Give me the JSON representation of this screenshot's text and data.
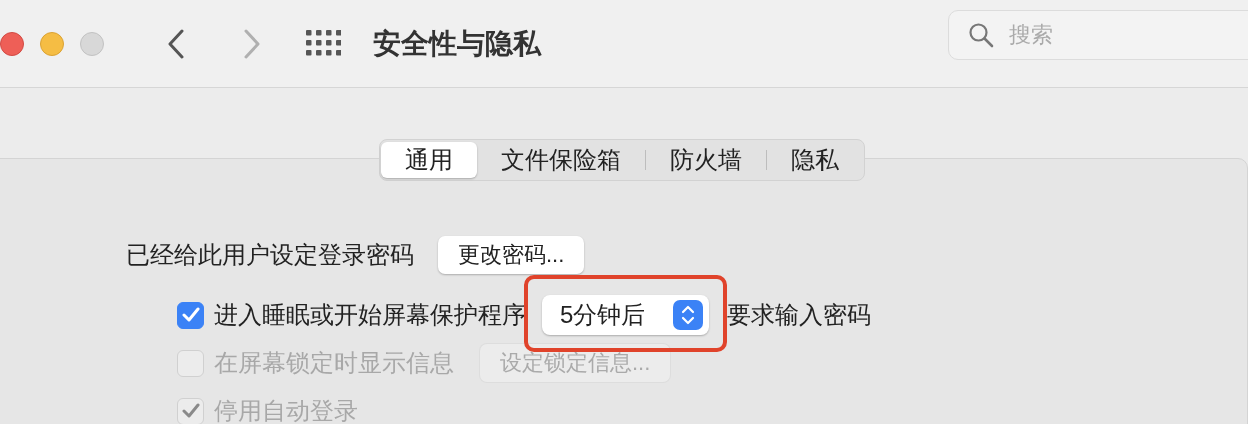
{
  "window": {
    "title": "安全性与隐私",
    "back_enabled": true,
    "forward_enabled": false
  },
  "search": {
    "placeholder": "搜索"
  },
  "tabs": [
    {
      "label": "通用",
      "selected": true
    },
    {
      "label": "文件保险箱",
      "selected": false
    },
    {
      "label": "防火墙",
      "selected": false
    },
    {
      "label": "隐私",
      "selected": false
    }
  ],
  "password_row": {
    "label": "已经给此用户设定登录密码",
    "button": "更改密码..."
  },
  "options": [
    {
      "kind": "popup",
      "label": "进入睡眠或开始屏幕保护程序",
      "checked": true,
      "disabled": false,
      "value": "5分钟后",
      "suffix": "要求输入密码",
      "highlighted": true
    },
    {
      "kind": "button",
      "label": "在屏幕锁定时显示信息",
      "checked": false,
      "disabled": true,
      "button": "设定锁定信息..."
    },
    {
      "kind": "plain",
      "label": "停用自动登录",
      "checked": true,
      "disabled": true
    }
  ]
}
